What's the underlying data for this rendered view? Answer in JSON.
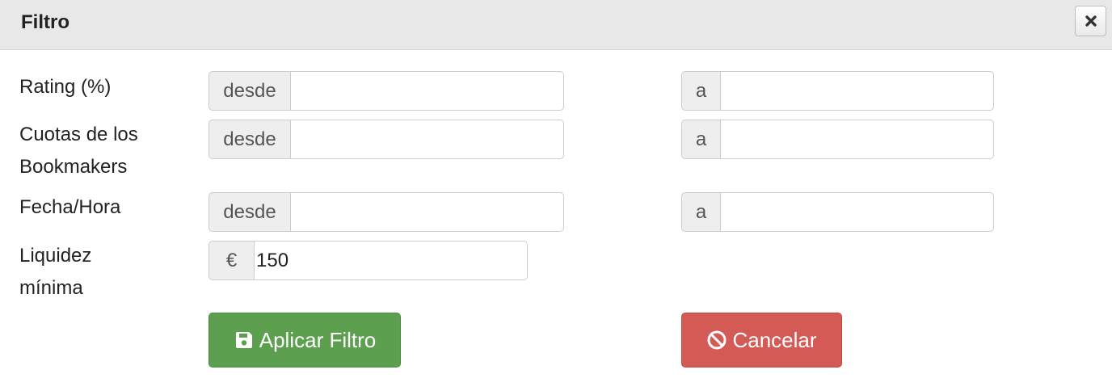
{
  "dialog": {
    "title": "Filtro",
    "close_icon": "close-x-icon"
  },
  "rows": {
    "rating": {
      "label": "Rating (%)",
      "from_prefix": "desde",
      "from_value": "",
      "to_prefix": "a",
      "to_value": ""
    },
    "odds": {
      "label_line1": "Cuotas de los",
      "label_line2": "Bookmakers",
      "from_prefix": "desde",
      "from_value": "",
      "to_prefix": "a",
      "to_value": ""
    },
    "datetime": {
      "label": "Fecha/Hora",
      "from_prefix": "desde",
      "from_value": "",
      "to_prefix": "a",
      "to_value": ""
    },
    "liquidity": {
      "label_line1": "Liquidez",
      "label_line2": "mínima",
      "currency": "€",
      "value": "150"
    }
  },
  "buttons": {
    "apply_label": "Aplicar Filtro",
    "apply_icon": "save-icon",
    "apply_color": "#5b9f4f",
    "cancel_label": "Cancelar",
    "cancel_icon": "ban-icon",
    "cancel_color": "#d35a55"
  }
}
